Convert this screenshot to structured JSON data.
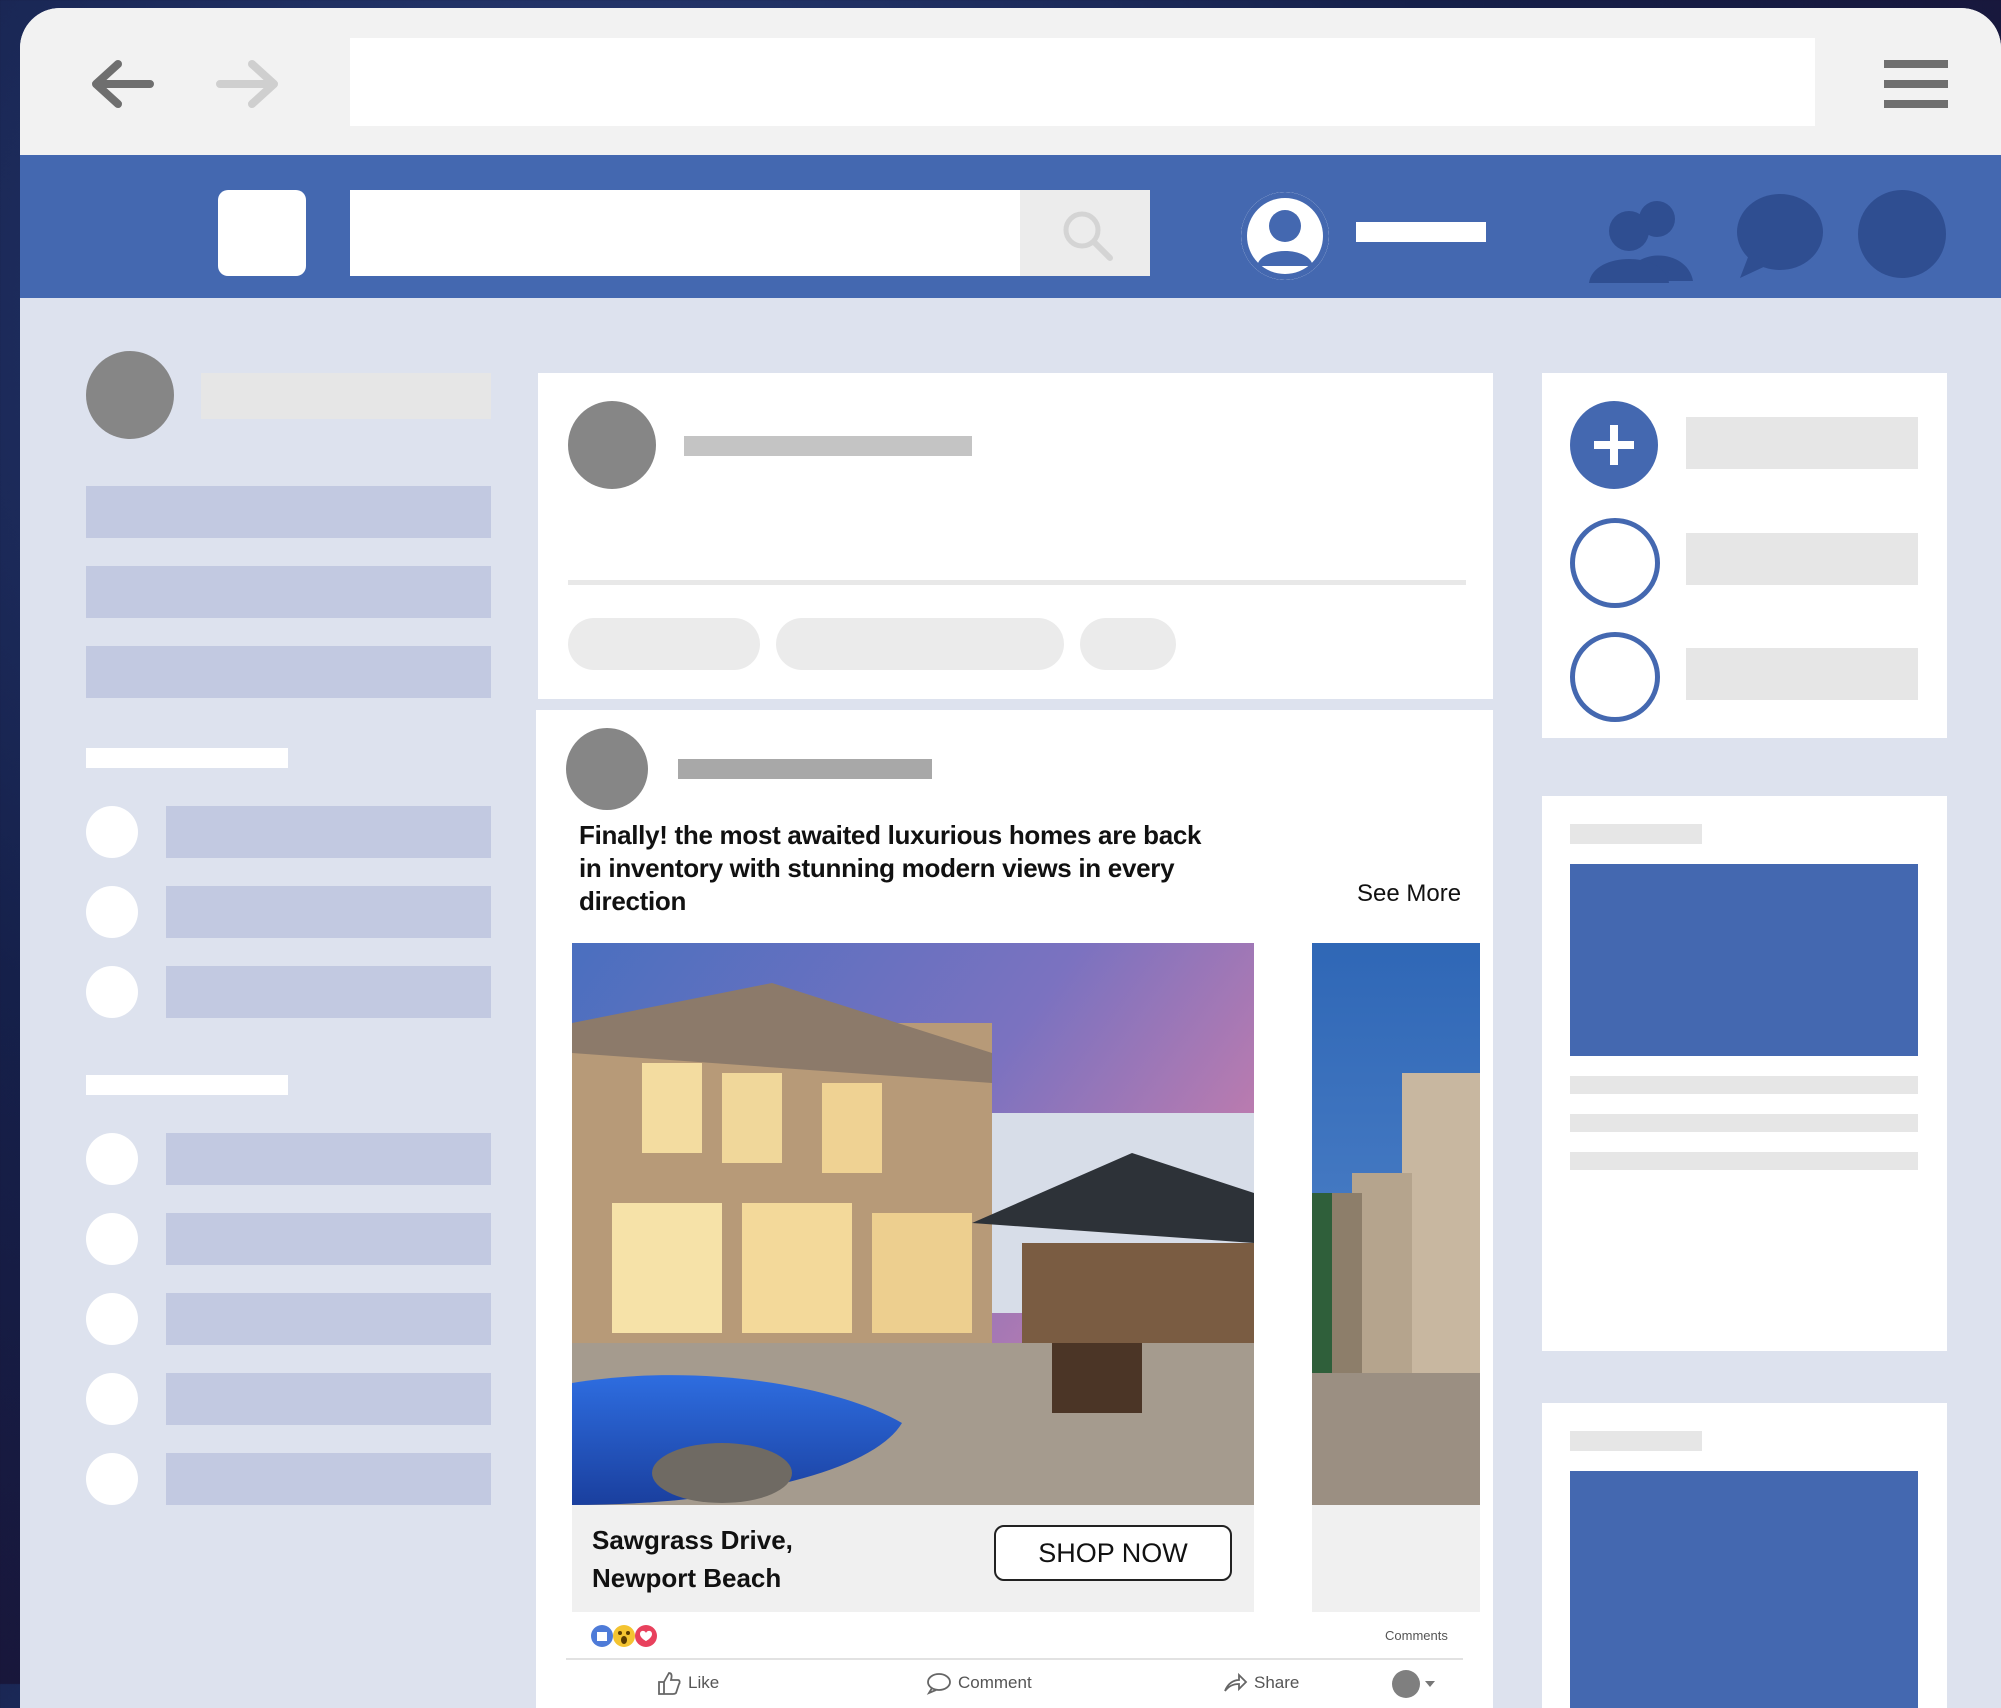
{
  "post": {
    "caption_line1": "Finally! the most awaited luxurious homes are back",
    "caption_line2": "in inventory with stunning modern views in every",
    "caption_line3": "direction",
    "see_more": "See More",
    "listing_line1": "Sawgrass Drive,",
    "listing_line2": "Newport Beach",
    "cta_button": "SHOP NOW",
    "comments_label": "Comments",
    "actions": {
      "like": "Like",
      "comment": "Comment",
      "share": "Share"
    }
  },
  "colors": {
    "facebook_blue": "#4468b0",
    "page_background": "#dde2ee",
    "placeholder_grey": "#e6e6e6",
    "placeholder_lavender": "#c2c9e1"
  },
  "icons": {
    "back": "arrow-left-icon",
    "forward": "arrow-right-icon",
    "menu": "hamburger-menu-icon",
    "search": "search-icon",
    "profile": "user-avatar-icon",
    "friends": "friends-icon",
    "messages": "chat-bubble-icon",
    "notifications": "notification-circle-icon",
    "create": "plus-icon"
  }
}
